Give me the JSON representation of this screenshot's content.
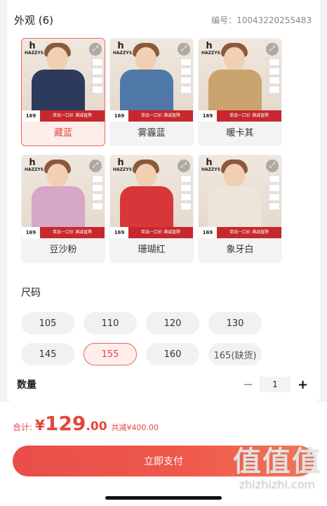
{
  "appearance": {
    "title": "外观 (6)",
    "code": "编号：10043220255483"
  },
  "variants": [
    {
      "label": "藏蓝",
      "selected": true,
      "color": "#2e3a5c",
      "tag": "169",
      "promo": "单品一口价 满减直降"
    },
    {
      "label": "雾霾蓝",
      "selected": false,
      "color": "#4f77a8",
      "tag": "169",
      "promo": "单品一口价 满减直降"
    },
    {
      "label": "暖卡其",
      "selected": false,
      "color": "#c9a46e",
      "tag": "169",
      "promo": "单品一口价 满减直降"
    },
    {
      "label": "豆沙粉",
      "selected": false,
      "color": "#d7a7c7",
      "tag": "169",
      "promo": "单品一口价 满减直降"
    },
    {
      "label": "珊瑚红",
      "selected": false,
      "color": "#d9363a",
      "tag": "169",
      "promo": "单品一口价 满减直降"
    },
    {
      "label": "象牙白",
      "selected": false,
      "color": "#eee5da",
      "tag": "169",
      "promo": "单品一口价 满减直降"
    }
  ],
  "brand": {
    "logo": "h",
    "name": "HAZZYS"
  },
  "size": {
    "title": "尺码",
    "options": [
      {
        "label": "105",
        "selected": false
      },
      {
        "label": "110",
        "selected": false
      },
      {
        "label": "120",
        "selected": false
      },
      {
        "label": "130",
        "selected": false
      },
      {
        "label": "145",
        "selected": false
      },
      {
        "label": "155",
        "selected": true
      },
      {
        "label": "160",
        "selected": false
      },
      {
        "label": "165(缺货)",
        "selected": false,
        "out_of_stock": true
      }
    ]
  },
  "quantity": {
    "label": "数量",
    "value": "1",
    "minus": "−",
    "plus": "+"
  },
  "checkout": {
    "total_label": "合计:",
    "currency": "¥",
    "amount_int": "129",
    "amount_dec": ".00",
    "saved": "共减¥400.00",
    "pay_label": "立即支付",
    "accent": "#e3473a"
  },
  "watermark": {
    "logo": "值值值",
    "url": "zhizhizhi.com"
  }
}
